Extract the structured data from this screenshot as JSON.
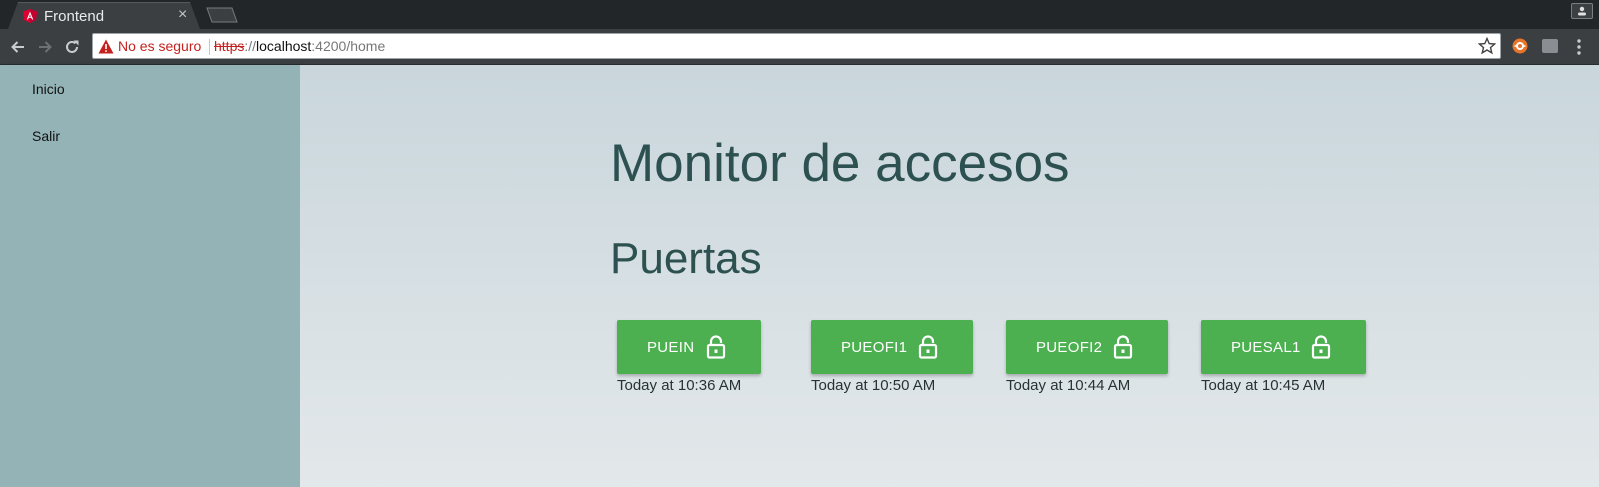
{
  "browser": {
    "tab_title": "Frontend",
    "tab_close": "×",
    "security_label": "No es seguro",
    "url_scheme": "https",
    "url_sep": "://",
    "url_host": "localhost",
    "url_rest": ":4200/home",
    "icons": [
      "angular-icon",
      "back-arrow-icon",
      "forward-arrow-icon",
      "reload-icon",
      "warning-icon",
      "bookmark-star-icon",
      "extension-icon",
      "chrome-menu-icon",
      "profile-icon"
    ]
  },
  "sidebar": {
    "items": [
      {
        "label": "Inicio"
      },
      {
        "label": "Salir"
      }
    ]
  },
  "main": {
    "title": "Monitor de accesos",
    "section_title": "Puertas",
    "doors": [
      {
        "name": "PUEIN",
        "time": "Today at 10:36 AM",
        "icon": "lock-open-icon"
      },
      {
        "name": "PUEOFI1",
        "time": "Today at 10:50 AM",
        "icon": "lock-open-icon"
      },
      {
        "name": "PUEOFI2",
        "time": "Today at 10:44 AM",
        "icon": "lock-open-icon"
      },
      {
        "name": "PUESAL1",
        "time": "Today at 10:45 AM",
        "icon": "lock-open-icon"
      }
    ]
  },
  "colors": {
    "accent_button": "#4caf50",
    "sidebar_bg": "#94b3b6",
    "heading": "#2d5050",
    "insecure": "#c5221f"
  }
}
